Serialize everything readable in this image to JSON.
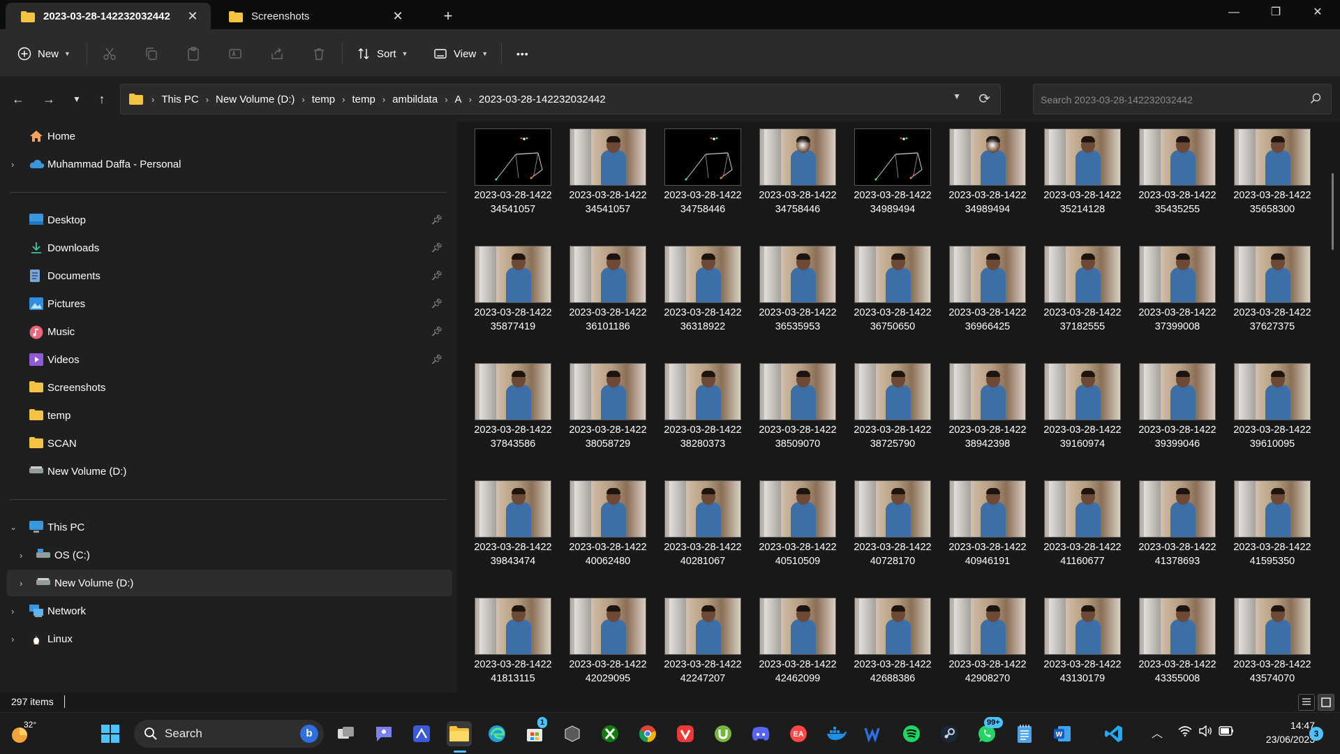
{
  "tabs": [
    {
      "title": "2023-03-28-142232032442",
      "active": true
    },
    {
      "title": "Screenshots",
      "active": false
    }
  ],
  "toolbar": {
    "new_label": "New",
    "sort_label": "Sort",
    "view_label": "View",
    "more_label": "•••"
  },
  "breadcrumb": [
    "This PC",
    "New Volume (D:)",
    "temp",
    "temp",
    "ambildata",
    "A",
    "2023-03-28-142232032442"
  ],
  "search": {
    "placeholder": "Search 2023-03-28-142232032442"
  },
  "sidebar": {
    "top": [
      {
        "label": "Home",
        "icon": "home-icon"
      },
      {
        "label": "Muhammad Daffa - Personal",
        "icon": "onedrive-cloud-icon"
      }
    ],
    "quick_access": [
      {
        "label": "Desktop",
        "icon": "desktop-icon"
      },
      {
        "label": "Downloads",
        "icon": "download-icon"
      },
      {
        "label": "Documents",
        "icon": "document-icon"
      },
      {
        "label": "Pictures",
        "icon": "pictures-icon"
      },
      {
        "label": "Music",
        "icon": "music-icon"
      },
      {
        "label": "Videos",
        "icon": "videos-icon"
      },
      {
        "label": "Screenshots",
        "icon": "folder-icon"
      },
      {
        "label": "temp",
        "icon": "folder-icon"
      },
      {
        "label": "SCAN",
        "icon": "folder-icon"
      },
      {
        "label": "New Volume (D:)",
        "icon": "drive-icon"
      }
    ],
    "this_pc": {
      "label": "This PC",
      "children": [
        {
          "label": "OS (C:)"
        },
        {
          "label": "New Volume (D:)"
        }
      ]
    },
    "network": {
      "label": "Network"
    },
    "linux": {
      "label": "Linux"
    }
  },
  "files": [
    {
      "l1": "2023-03-28-1422",
      "l2": "34541057",
      "kind": "skeleton"
    },
    {
      "l1": "2023-03-28-1422",
      "l2": "34541057",
      "kind": "photo"
    },
    {
      "l1": "2023-03-28-1422",
      "l2": "34758446",
      "kind": "skeleton"
    },
    {
      "l1": "2023-03-28-1422",
      "l2": "34758446",
      "kind": "photo"
    },
    {
      "l1": "2023-03-28-1422",
      "l2": "34989494",
      "kind": "skeleton"
    },
    {
      "l1": "2023-03-28-1422",
      "l2": "34989494",
      "kind": "photo"
    },
    {
      "l1": "2023-03-28-1422",
      "l2": "35214128",
      "kind": "photo"
    },
    {
      "l1": "2023-03-28-1422",
      "l2": "35435255",
      "kind": "photo"
    },
    {
      "l1": "2023-03-28-1422",
      "l2": "35658300",
      "kind": "photo"
    },
    {
      "l1": "2023-03-28-1422",
      "l2": "35877419",
      "kind": "photo"
    },
    {
      "l1": "2023-03-28-1422",
      "l2": "36101186",
      "kind": "photo"
    },
    {
      "l1": "2023-03-28-1422",
      "l2": "36318922",
      "kind": "photo"
    },
    {
      "l1": "2023-03-28-1422",
      "l2": "36535953",
      "kind": "photo"
    },
    {
      "l1": "2023-03-28-1422",
      "l2": "36750650",
      "kind": "photo"
    },
    {
      "l1": "2023-03-28-1422",
      "l2": "36966425",
      "kind": "photo"
    },
    {
      "l1": "2023-03-28-1422",
      "l2": "37182555",
      "kind": "photo"
    },
    {
      "l1": "2023-03-28-1422",
      "l2": "37399008",
      "kind": "photo"
    },
    {
      "l1": "2023-03-28-1422",
      "l2": "37627375",
      "kind": "photo"
    },
    {
      "l1": "2023-03-28-1422",
      "l2": "37843586",
      "kind": "photo"
    },
    {
      "l1": "2023-03-28-1422",
      "l2": "38058729",
      "kind": "photo"
    },
    {
      "l1": "2023-03-28-1422",
      "l2": "38280373",
      "kind": "photo"
    },
    {
      "l1": "2023-03-28-1422",
      "l2": "38509070",
      "kind": "photo"
    },
    {
      "l1": "2023-03-28-1422",
      "l2": "38725790",
      "kind": "photo"
    },
    {
      "l1": "2023-03-28-1422",
      "l2": "38942398",
      "kind": "photo"
    },
    {
      "l1": "2023-03-28-1422",
      "l2": "39160974",
      "kind": "photo"
    },
    {
      "l1": "2023-03-28-1422",
      "l2": "39399046",
      "kind": "photo"
    },
    {
      "l1": "2023-03-28-1422",
      "l2": "39610095",
      "kind": "photo"
    },
    {
      "l1": "2023-03-28-1422",
      "l2": "39843474",
      "kind": "photo"
    },
    {
      "l1": "2023-03-28-1422",
      "l2": "40062480",
      "kind": "photo"
    },
    {
      "l1": "2023-03-28-1422",
      "l2": "40281067",
      "kind": "photo"
    },
    {
      "l1": "2023-03-28-1422",
      "l2": "40510509",
      "kind": "photo"
    },
    {
      "l1": "2023-03-28-1422",
      "l2": "40728170",
      "kind": "photo"
    },
    {
      "l1": "2023-03-28-1422",
      "l2": "40946191",
      "kind": "photo"
    },
    {
      "l1": "2023-03-28-1422",
      "l2": "41160677",
      "kind": "photo"
    },
    {
      "l1": "2023-03-28-1422",
      "l2": "41378693",
      "kind": "photo"
    },
    {
      "l1": "2023-03-28-1422",
      "l2": "41595350",
      "kind": "photo"
    },
    {
      "l1": "2023-03-28-1422",
      "l2": "41813115",
      "kind": "photo"
    },
    {
      "l1": "2023-03-28-1422",
      "l2": "42029095",
      "kind": "photo"
    },
    {
      "l1": "2023-03-28-1422",
      "l2": "42247207",
      "kind": "photo"
    },
    {
      "l1": "2023-03-28-1422",
      "l2": "42462099",
      "kind": "photo"
    },
    {
      "l1": "2023-03-28-1422",
      "l2": "42688386",
      "kind": "photo"
    },
    {
      "l1": "2023-03-28-1422",
      "l2": "42908270",
      "kind": "photo"
    },
    {
      "l1": "2023-03-28-1422",
      "l2": "43130179",
      "kind": "photo"
    },
    {
      "l1": "2023-03-28-1422",
      "l2": "43355008",
      "kind": "photo"
    },
    {
      "l1": "2023-03-28-1422",
      "l2": "43574070",
      "kind": "photo"
    }
  ],
  "status": {
    "item_count": "297 items"
  },
  "taskbar": {
    "weather_temp": "32°",
    "search_label": "Search",
    "store_badge": "1",
    "whatsapp_badge": "99+",
    "time": "14:47",
    "date": "23/06/2023",
    "notification_count": "3"
  },
  "colors": {
    "accent": "#4cc2ff",
    "folder": "#f5c342",
    "bg": "#191919",
    "sidebar": "#1f1f1f"
  }
}
